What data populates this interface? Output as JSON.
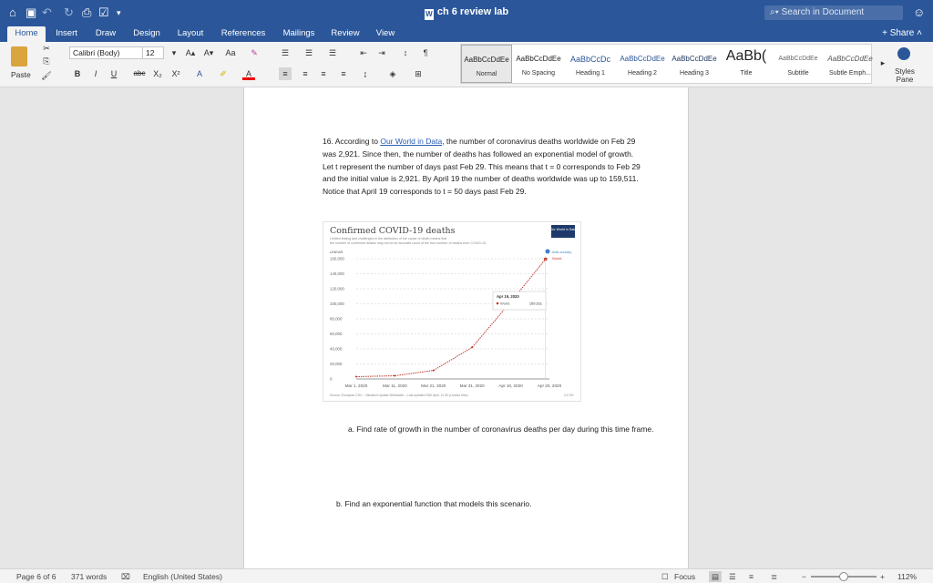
{
  "window": {
    "title": "ch 6 review lab",
    "search_placeholder": "Search in Document"
  },
  "tabs": [
    "Home",
    "Insert",
    "Draw",
    "Design",
    "Layout",
    "References",
    "Mailings",
    "Review",
    "View"
  ],
  "share_label": "Share",
  "ribbon": {
    "paste_label": "Paste",
    "font_name": "Calibri (Body)",
    "font_size": "12",
    "styles": [
      {
        "preview": "AaBbCcDdEe",
        "name": "Normal"
      },
      {
        "preview": "AaBbCcDdEe",
        "name": "No Spacing"
      },
      {
        "preview": "AaBbCcDc",
        "name": "Heading 1"
      },
      {
        "preview": "AaBbCcDdEe",
        "name": "Heading 2"
      },
      {
        "preview": "AaBbCcDdEe",
        "name": "Heading 3"
      },
      {
        "preview": "AaBb(",
        "name": "Title"
      },
      {
        "preview": "AaBbCcDdEe",
        "name": "Subtitle"
      },
      {
        "preview": "AaBbCcDdEe",
        "name": "Subtle Emph..."
      }
    ],
    "styles_pane_label": "Styles Pane"
  },
  "doc": {
    "q_num": "16. According to ",
    "q_link": "Our World in Data",
    "q_rest": ", the number of coronavirus deaths worldwide on Feb 29 was 2,921. Since then, the number of deaths has followed an exponential model of growth. Let t represent the number of days past Feb 29. This means that t = 0 corresponds to Feb 29 and the initial value is 2,921. By April 19 the number of deaths worldwide was up to 159,511. Notice that April 19 corresponds to t = 50 days past Feb 29.",
    "part_a": "a.  Find rate of growth in the number of coronavirus deaths per day during this time frame.",
    "part_b": "b.  Find an exponential function that models this scenario."
  },
  "chart_data": {
    "type": "line",
    "title": "Confirmed COVID-19 deaths",
    "subtitle": "Limited testing and challenges in the attribution of the cause of death means that the number of confirmed deaths may not be an accurate count of the true number of deaths from COVID-19.",
    "badge": "Our World in Data",
    "ylabel": "LINEAR",
    "add_country": "Add country",
    "legend": "World",
    "x": [
      "Mar 1, 2020",
      "Mar 11, 2020",
      "Mar 21, 2020",
      "Mar 31, 2020",
      "Apr 10, 2020",
      "Apr 19, 2020"
    ],
    "series": [
      {
        "name": "World",
        "values": [
          3000,
          4300,
          11400,
          42100,
          102500,
          159511
        ]
      }
    ],
    "x_ticks": [
      "Mar 1, 2020",
      "Mar 11, 2020",
      "Mar 21, 2020",
      "Mar 31, 2020",
      "Apr 10, 2020",
      "Apr 20, 2020"
    ],
    "y_ticks": [
      "0",
      "20,000",
      "40,000",
      "60,000",
      "80,000",
      "100,000",
      "120,000",
      "140,000",
      "160,000"
    ],
    "ylim": [
      0,
      160000
    ],
    "tooltip_date": "Apr 19, 2020",
    "tooltip_series": "World",
    "tooltip_value": "159,511",
    "source": "Source: European CDC – Situation Update Worldwide – Last updated 20th April, 11:30 (London time)",
    "license": "CC BY",
    "line_color": "#c0392b"
  },
  "status": {
    "page": "Page 6 of 6",
    "words": "371 words",
    "language": "English (United States)",
    "focus": "Focus",
    "zoom": "112%"
  }
}
